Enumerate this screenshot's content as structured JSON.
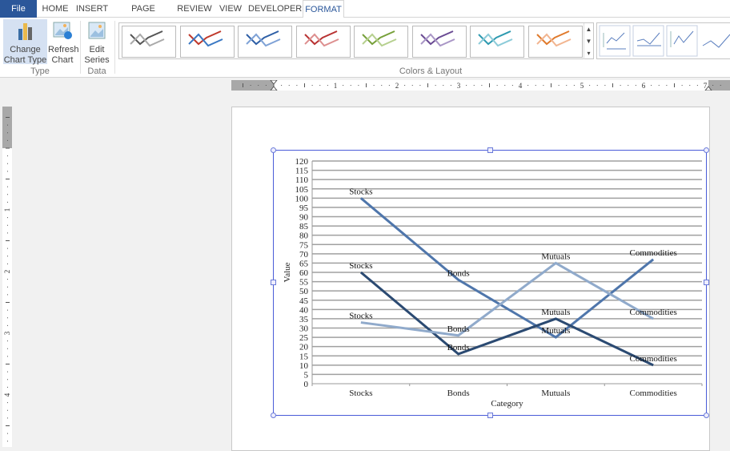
{
  "tabs": [
    "File",
    "HOME",
    "INSERT",
    "PAGE LAYOUT",
    "REVIEW",
    "VIEW",
    "DEVELOPER",
    "FORMAT"
  ],
  "active_tab": "FORMAT",
  "ribbon": {
    "change_chart_type": [
      "Change",
      "Chart Type"
    ],
    "refresh_chart": [
      "Refresh",
      "Chart"
    ],
    "edit_series": [
      "Edit",
      "Series"
    ],
    "group_type": "Type",
    "group_data": "Data",
    "group_colors": "Colors & Layout",
    "color_styles": [
      {
        "dark": "#555555",
        "light": "#aaaaaa"
      },
      {
        "dark": "#c0392b",
        "light": "#3a78c3"
      },
      {
        "dark": "#2e5fa6",
        "light": "#7fa2d6"
      },
      {
        "dark": "#b83232",
        "light": "#dd8f8f"
      },
      {
        "dark": "#77a03a",
        "light": "#b6d08f"
      },
      {
        "dark": "#6a4b93",
        "light": "#a996c6"
      },
      {
        "dark": "#2e9ab0",
        "light": "#8ccbd9"
      },
      {
        "dark": "#e07a2c",
        "light": "#f2b590"
      }
    ]
  },
  "ruler": {
    "labels": [
      "1",
      "2",
      "3",
      "4",
      "5",
      "6",
      "7"
    ]
  },
  "vruler": {
    "labels": [
      "1",
      "2",
      "3",
      "4"
    ]
  },
  "chart_data": {
    "type": "line",
    "categories": [
      "Stocks",
      "Bonds",
      "Mutuals",
      "Commodities"
    ],
    "xlabel": "Category",
    "ylabel": "Value",
    "ylim": [
      0,
      120
    ],
    "ytick_step": 5,
    "grid": true,
    "data_labels": "category name",
    "series": [
      {
        "values": [
          100,
          56,
          25,
          67
        ],
        "color": "#4f76ab"
      },
      {
        "values": [
          60,
          16,
          35,
          10
        ],
        "color": "#2b4a72"
      },
      {
        "values": [
          33,
          26,
          65,
          35
        ],
        "color": "#90aacb"
      }
    ]
  }
}
